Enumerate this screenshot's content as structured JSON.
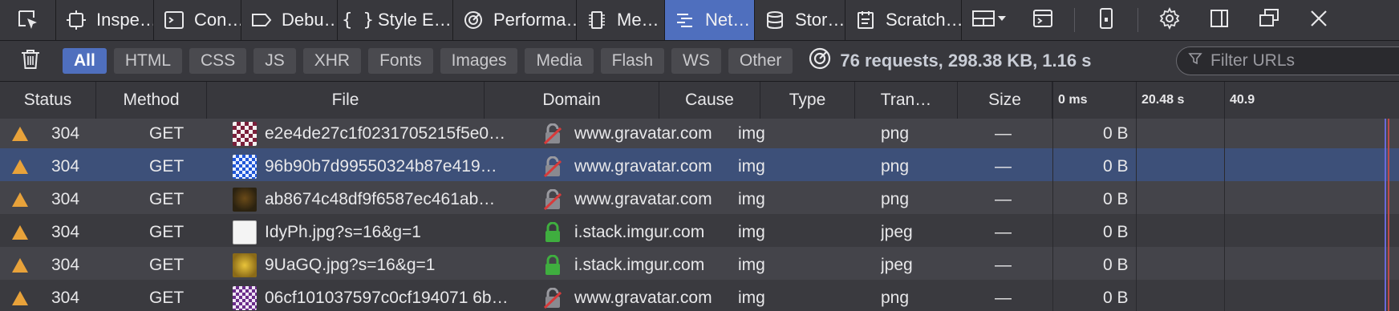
{
  "toolbar": {
    "picker_label": "",
    "tabs": [
      {
        "label": "Inspe…",
        "icon": "inspector-icon"
      },
      {
        "label": "Con…",
        "icon": "console-icon"
      },
      {
        "label": "Debu…",
        "icon": "debugger-icon"
      },
      {
        "label": "Style E…",
        "icon": "style-editor-icon"
      },
      {
        "label": "Performa…",
        "icon": "performance-icon"
      },
      {
        "label": "Me…",
        "icon": "memory-icon"
      },
      {
        "label": "Net…",
        "icon": "network-icon",
        "selected": true
      },
      {
        "label": "Stor…",
        "icon": "storage-icon"
      },
      {
        "label": "Scratch…",
        "icon": "scratchpad-icon"
      }
    ]
  },
  "filters": {
    "buttons": [
      "All",
      "HTML",
      "CSS",
      "JS",
      "XHR",
      "Fonts",
      "Images",
      "Media",
      "Flash",
      "WS",
      "Other"
    ],
    "active": "All",
    "summary": "76 requests, 298.38 KB, 1.16 s",
    "search_placeholder": "Filter URLs"
  },
  "columns": {
    "status": "Status",
    "method": "Method",
    "file": "File",
    "domain": "Domain",
    "cause": "Cause",
    "type": "Type",
    "transferred": "Tran…",
    "size": "Size",
    "wf_ticks": [
      "0 ms",
      "20.48 s",
      "40.9"
    ]
  },
  "requests": [
    {
      "status": "304",
      "method": "GET",
      "file": "e2e4de27c1f0231705215f5e0…",
      "domain": "www.gravatar.com",
      "secure": false,
      "cause": "img",
      "type": "png",
      "transferred": "—",
      "size": "0 B",
      "thumb": "gravatar-red"
    },
    {
      "status": "304",
      "method": "GET",
      "file": "96b90b7d99550324b87e419…",
      "domain": "www.gravatar.com",
      "secure": false,
      "cause": "img",
      "type": "png",
      "transferred": "—",
      "size": "0 B",
      "thumb": "gravatar-blue",
      "selected": true
    },
    {
      "status": "304",
      "method": "GET",
      "file": "ab8674c48df9f6587ec461ab…",
      "domain": "www.gravatar.com",
      "secure": false,
      "cause": "img",
      "type": "png",
      "transferred": "—",
      "size": "0 B",
      "thumb": "gravatar-dark"
    },
    {
      "status": "304",
      "method": "GET",
      "file": "IdyPh.jpg?s=16&g=1",
      "domain": "i.stack.imgur.com",
      "secure": true,
      "cause": "img",
      "type": "jpeg",
      "transferred": "—",
      "size": "0 B",
      "thumb": "imgur-white"
    },
    {
      "status": "304",
      "method": "GET",
      "file": "9UaGQ.jpg?s=16&g=1",
      "domain": "i.stack.imgur.com",
      "secure": true,
      "cause": "img",
      "type": "jpeg",
      "transferred": "—",
      "size": "0 B",
      "thumb": "imgur-yellow"
    },
    {
      "status": "304",
      "method": "GET",
      "file": "06cf101037597c0cf194071 6b…",
      "domain": "www.gravatar.com",
      "secure": false,
      "cause": "img",
      "type": "png",
      "transferred": "—",
      "size": "0 B",
      "thumb": "gravatar-purple"
    }
  ],
  "colors": {
    "selected_tab": "#4f6fbe",
    "warning": "#e8a23a",
    "secure_lock": "#3fae3f",
    "insecure_lock": "#d73a3a"
  }
}
